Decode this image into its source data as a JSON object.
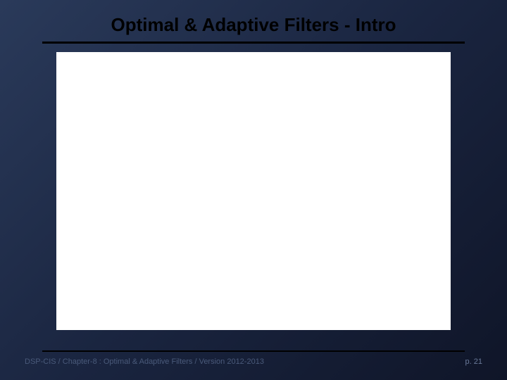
{
  "header": {
    "title": "Optimal & Adaptive Filters - Intro"
  },
  "footer": {
    "left": "DSP-CIS  /  Chapter-8 : Optimal & Adaptive Filters   /  Version 2012-2013",
    "page": "p. 21"
  }
}
